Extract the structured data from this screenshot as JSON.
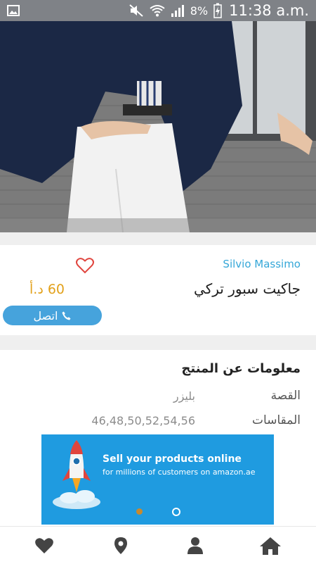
{
  "status_bar": {
    "battery": "8%",
    "time": "11:38 a.m."
  },
  "product": {
    "brand": "Silvio Massimo",
    "title": "جاكيت سبور تركي",
    "price": "60 د.أ",
    "contact_label": "اتصل"
  },
  "info": {
    "heading": "معلومات عن المنتج",
    "rows": [
      {
        "label": "القصة",
        "value": "بليزر"
      },
      {
        "label": "المقاسات",
        "value": "46,48,50,52,54,56"
      }
    ]
  },
  "banner": {
    "title": "Sell your products online",
    "subtitle": "for millions of customers on amazon.ae",
    "active_dot": 1
  },
  "colors": {
    "accent_blue": "#46a3dc",
    "brand_blue": "#35a7d8",
    "price_orange": "#e2a11b",
    "heart_red": "#e0453e",
    "banner_blue": "#1f9be0"
  },
  "nav": [
    "home-icon",
    "person-icon",
    "location-pin-icon",
    "favorites-heart-icon"
  ]
}
